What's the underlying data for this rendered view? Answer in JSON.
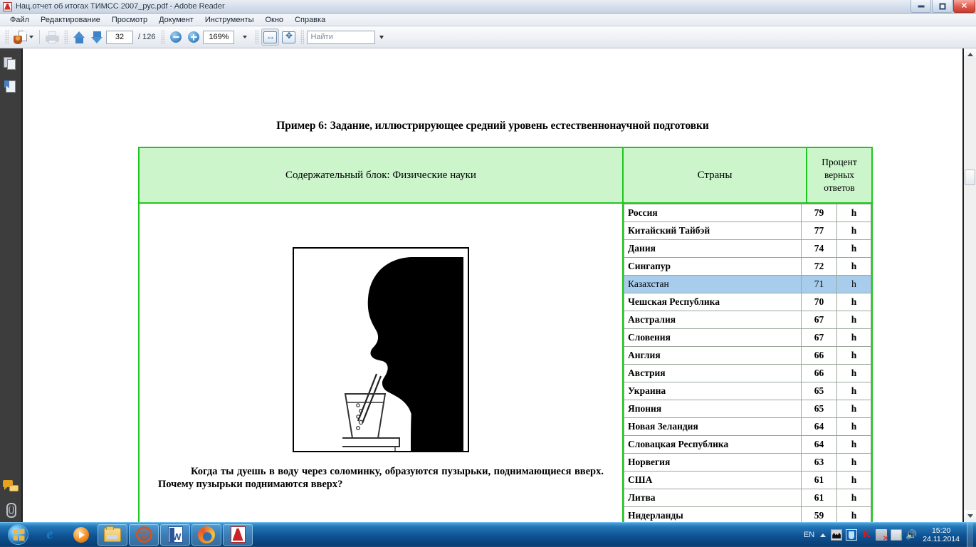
{
  "window": {
    "title": "Нац.отчет об итогах ТИМСС 2007_рус.pdf - Adobe Reader",
    "icon": "acrobat-icon",
    "minimize_label": "",
    "maximize_label": "",
    "close_label": "✕"
  },
  "menubar": {
    "items": [
      {
        "label": "Файл"
      },
      {
        "label": "Редактирование"
      },
      {
        "label": "Просмотр"
      },
      {
        "label": "Документ"
      },
      {
        "label": "Инструменты"
      },
      {
        "label": "Окно"
      },
      {
        "label": "Справка"
      }
    ]
  },
  "toolbar": {
    "create_pdf": "create-pdf-icon",
    "print": "print-icon",
    "prev_page": "arrow-up-icon",
    "next_page": "arrow-down-icon",
    "page_current": "32",
    "page_total": "/ 126",
    "zoom_out": "zoom-out-icon",
    "zoom_in": "zoom-in-icon",
    "zoom_level": "169%",
    "fit_width": "fit-width-icon",
    "fit_page": "fit-page-icon",
    "find_placeholder": "Найти",
    "find_value": ""
  },
  "navpane": {
    "items": [
      {
        "name": "page-thumbnails",
        "label": "Страницы"
      },
      {
        "name": "bookmarks",
        "label": "Закладки"
      },
      {
        "name": "comments",
        "label": "Комментарии"
      },
      {
        "name": "attachments",
        "label": "Вложения"
      }
    ]
  },
  "document": {
    "title": "Пример 6: Задание, иллюстрирующее средний уровень естественнонаучной подготовки",
    "header": {
      "content_block": "Содержательный блок: Физические науки",
      "countries": "Страны",
      "percent_correct": "Процент\nверных\nответов",
      "percent_line1": "Процент",
      "percent_line2": "верных",
      "percent_line3": "ответов"
    },
    "figure_alt": "Силуэт человека, дующего через соломинку в стакан с водой",
    "question": "Когда ты дуешь в воду через соломинку, образуются пузырьки, поднимающиеся вверх. Почему пузырьки поднимаются вверх?",
    "rows": [
      {
        "country": "Россия",
        "percent": "79",
        "symbol": "h",
        "highlighted": false
      },
      {
        "country": "Китайский Тайбэй",
        "percent": "77",
        "symbol": "h",
        "highlighted": false
      },
      {
        "country": "Дания",
        "percent": "74",
        "symbol": "h",
        "highlighted": false
      },
      {
        "country": "Сингапур",
        "percent": "72",
        "symbol": "h",
        "highlighted": false
      },
      {
        "country": "Казахстан",
        "percent": "71",
        "symbol": "h",
        "highlighted": true
      },
      {
        "country": "Чешская Республика",
        "percent": "70",
        "symbol": "h",
        "highlighted": false
      },
      {
        "country": "Австралия",
        "percent": "67",
        "symbol": "h",
        "highlighted": false
      },
      {
        "country": "Словения",
        "percent": "67",
        "symbol": "h",
        "highlighted": false
      },
      {
        "country": "Англия",
        "percent": "66",
        "symbol": "h",
        "highlighted": false
      },
      {
        "country": "Австрия",
        "percent": "66",
        "symbol": "h",
        "highlighted": false
      },
      {
        "country": "Украина",
        "percent": "65",
        "symbol": "h",
        "highlighted": false
      },
      {
        "country": "Япония",
        "percent": "65",
        "symbol": "h",
        "highlighted": false
      },
      {
        "country": "Новая Зеландия",
        "percent": "64",
        "symbol": "h",
        "highlighted": false
      },
      {
        "country": "Словацкая Республика",
        "percent": "64",
        "symbol": "h",
        "highlighted": false
      },
      {
        "country": "Норвегия",
        "percent": "63",
        "symbol": "h",
        "highlighted": false
      },
      {
        "country": "США",
        "percent": "61",
        "symbol": "h",
        "highlighted": false
      },
      {
        "country": "Литва",
        "percent": "61",
        "symbol": "h",
        "highlighted": false
      },
      {
        "country": "Нидерланды",
        "percent": "59",
        "symbol": "h",
        "highlighted": false
      }
    ]
  },
  "colors": {
    "table_border_green": "#1fc61f",
    "header_fill_green": "#ccf5cc",
    "highlight_blue": "#a8cdec",
    "taskbar_blue": "#0e5394"
  },
  "taskbar": {
    "start_label": "Пуск",
    "items": [
      {
        "name": "internet-explorer",
        "label": "Internet Explorer"
      },
      {
        "name": "windows-media-player",
        "label": "Проигрыватель Windows Media"
      },
      {
        "name": "windows-explorer",
        "label": "Проводник"
      },
      {
        "name": "mail-client",
        "label": "The Bat!"
      },
      {
        "name": "microsoft-word",
        "label": "Microsoft Word"
      },
      {
        "name": "firefox",
        "label": "Mozilla Firefox"
      },
      {
        "name": "adobe-reader",
        "label": "Adobe Reader"
      }
    ],
    "tray": {
      "language": "EN",
      "icons": [
        {
          "name": "the-bat-icon"
        },
        {
          "name": "blue-app-icon"
        },
        {
          "name": "kaspersky-icon"
        },
        {
          "name": "network-disconnected-icon"
        },
        {
          "name": "action-center-flag-icon"
        },
        {
          "name": "volume-icon"
        }
      ],
      "time": "15:20",
      "date": "24.11.2014"
    }
  }
}
